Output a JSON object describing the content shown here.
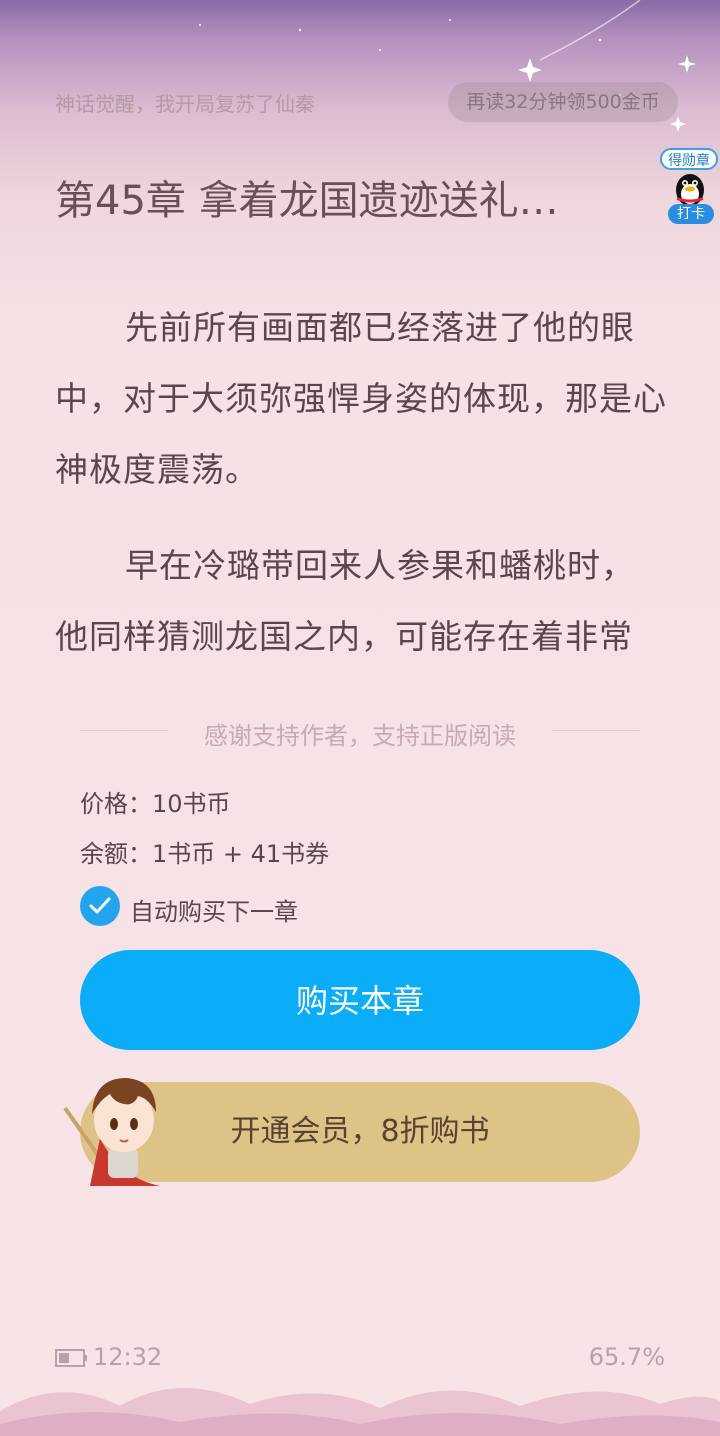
{
  "header": {
    "book_title": "神话觉醒，我开局复苏了仙秦",
    "reward_text": "再读32分钟领500金币"
  },
  "badge": {
    "top_label": "得勋章",
    "bottom_label": "打卡"
  },
  "chapter": {
    "title": "第45章 拿着龙国遗迹送礼…",
    "paragraphs": [
      "先前所有画面都已经落进了他的眼中，对于大须弥强悍身姿的体现，那是心神极度震荡。",
      "早在冷璐带回来人参果和蟠桃时，他同样猜测龙国之内，可能存在着非常"
    ]
  },
  "paywall": {
    "divider_text": "感谢支持作者，支持正版阅读",
    "price_text": "价格：10书币",
    "balance_text": "余额：1书币 + 41书券",
    "auto_buy_label": "自动购买下一章",
    "auto_buy_checked": true,
    "buy_button_label": "购买本章",
    "vip_button_label": "开通会员，8折购书"
  },
  "footer": {
    "time": "12:32",
    "progress": "65.7%"
  },
  "colors": {
    "buy_button": "#0bacf8",
    "vip_button": "#dec386",
    "checkbox": "#25a4ee"
  },
  "icons": [
    "battery-icon",
    "check-icon",
    "qq-penguin-icon"
  ]
}
